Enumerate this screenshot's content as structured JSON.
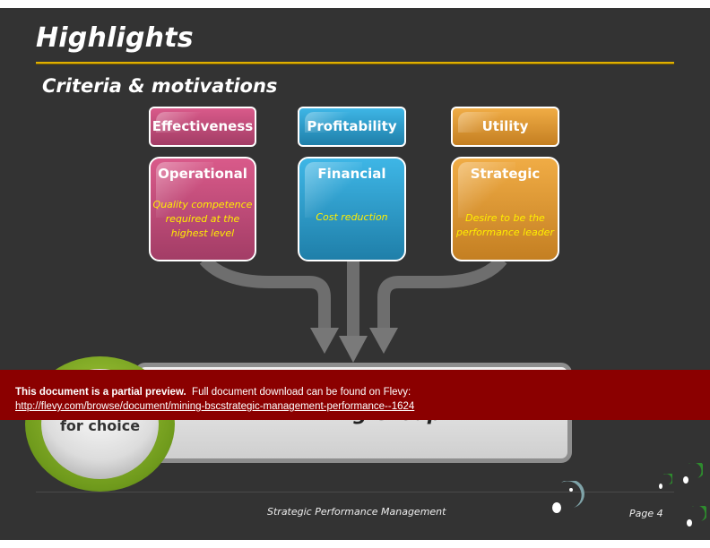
{
  "slide": {
    "title": "Highlights",
    "subtitle": "Criteria & motivations",
    "criteria": [
      {
        "header": "Effectiveness",
        "card_title": "Operational",
        "card_text": "Quality competence required at the highest level",
        "color": "#c94a7a"
      },
      {
        "header": "Profitability",
        "card_title": "Financial",
        "card_text": "Cost reduction",
        "color": "#2b9bcf"
      },
      {
        "header": "Utility",
        "card_title": "Strategic",
        "card_text": "Desire to be the performance leader",
        "color": "#e0962f"
      }
    ],
    "circle_text": "for choice",
    "result_box_text": "Mining Group",
    "footer_text": "Strategic Performance Management",
    "page_label": "Page 4",
    "accent_color": "#e0b000"
  },
  "banner": {
    "bold_text": "This document is a partial preview.",
    "text": "Full document download can be found on Flevy:",
    "link": "http://flevy.com/browse/document/mining-bscstrategic-management-performance--1624",
    "color": "#8b0000"
  }
}
